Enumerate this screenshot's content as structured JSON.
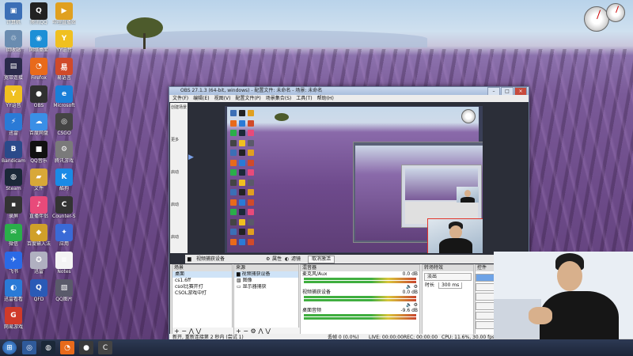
{
  "colors": {
    "taskbar": "#1c2538",
    "obs_bg": "#2b2e38",
    "selection_border": "#e3362b",
    "lavender": "#6c4a88"
  },
  "desktop_icons": [
    {
      "label": "计算机",
      "icon": "computer-icon",
      "color": "#3b6fb6",
      "glyph": "▣"
    },
    {
      "label": "腾讯QQ",
      "icon": "qq-penguin-icon",
      "color": "#222222",
      "glyph": "Q"
    },
    {
      "label": "哔哩直播姬",
      "icon": "live-app-icon",
      "color": "#e0a020",
      "glyph": "▶"
    },
    {
      "label": "回收站",
      "icon": "recycle-bin-icon",
      "color": "#6a8cb0",
      "glyph": "♲"
    },
    {
      "label": "网络桌面",
      "icon": "network-icon",
      "color": "#1d8fd6",
      "glyph": "◉"
    },
    {
      "label": "YY语音",
      "icon": "yy-icon",
      "color": "#f0c020",
      "glyph": "Y"
    },
    {
      "label": "宽带连接",
      "icon": "file-icon",
      "color": "#2a2a4a",
      "glyph": "▤"
    },
    {
      "label": "Firefox",
      "icon": "firefox-icon",
      "color": "#e86a1b",
      "glyph": "◔"
    },
    {
      "label": "易语言",
      "icon": "app-icon",
      "color": "#d04a2a",
      "glyph": "易"
    },
    {
      "label": "YY语音",
      "icon": "yy-icon",
      "color": "#f0c020",
      "glyph": "Y"
    },
    {
      "label": "OBS",
      "icon": "obs-icon",
      "color": "#303030",
      "glyph": "●"
    },
    {
      "label": "Microsoft",
      "icon": "edge-icon",
      "color": "#1a7fd8",
      "glyph": "e"
    },
    {
      "label": "迅雷",
      "icon": "thunder-icon",
      "color": "#2a7ad6",
      "glyph": "⚡"
    },
    {
      "label": "百度网盘",
      "icon": "netdisk-icon",
      "color": "#3a8fe6",
      "glyph": "☁"
    },
    {
      "label": "CSGO",
      "icon": "game-icon",
      "color": "#444444",
      "glyph": "◎"
    },
    {
      "label": "Bandicam",
      "icon": "bandicam-icon",
      "color": "#2a4a8a",
      "glyph": "B"
    },
    {
      "label": "QQ音乐",
      "icon": "black-app-icon",
      "color": "#111111",
      "glyph": "■"
    },
    {
      "label": "腾讯游戏",
      "icon": "gear-app-icon",
      "color": "#7a7a7a",
      "glyph": "⚙"
    },
    {
      "label": "Steam",
      "icon": "steam-icon",
      "color": "#1b2838",
      "glyph": "◍"
    },
    {
      "label": "文件",
      "icon": "folder-icon",
      "color": "#d8a838",
      "glyph": "▰"
    },
    {
      "label": "酷狗",
      "icon": "kugou-icon",
      "color": "#1a8ae6",
      "glyph": "K"
    },
    {
      "label": "录屏",
      "icon": "camera-app-icon",
      "color": "#333333",
      "glyph": "▪"
    },
    {
      "label": "直播伴侣",
      "icon": "live-app-icon",
      "color": "#e84a7a",
      "glyph": "♪"
    },
    {
      "label": "Counter-Strike",
      "icon": "cs-icon",
      "color": "#333333",
      "glyph": "C"
    },
    {
      "label": "微信",
      "icon": "wechat-icon",
      "color": "#2aae4a",
      "glyph": "✉"
    },
    {
      "label": "百度输入法",
      "icon": "app-icon",
      "color": "#d0a02a",
      "glyph": "◆"
    },
    {
      "label": "应用",
      "icon": "app-icon",
      "color": "#3a6ad6",
      "glyph": "✦"
    },
    {
      "label": "飞书",
      "icon": "feishu-icon",
      "color": "#2a6ae6",
      "glyph": "✈"
    },
    {
      "label": "迅雷",
      "icon": "tray-app-icon",
      "color": "#b0b0c0",
      "glyph": "✪"
    },
    {
      "label": "Notes",
      "icon": "document-icon",
      "color": "#f4f4f4",
      "glyph": "≡"
    },
    {
      "label": "迅雷看看",
      "icon": "blue-bird-icon",
      "color": "#2a7ad6",
      "glyph": "◐"
    },
    {
      "label": "QFD",
      "icon": "qfd-icon",
      "color": "#2a5ab6",
      "glyph": "Q"
    },
    {
      "label": "QQ图片",
      "icon": "image-icon",
      "color": "#5a5a6a",
      "glyph": "▧"
    },
    {
      "label": "网易游戏",
      "icon": "game-platform-icon",
      "color": "#d03a2a",
      "glyph": "G"
    }
  ],
  "obs": {
    "title": "OBS 27.1.3 (64-bit, windows) - 配置文件: 未命名 - 场景: 未命名",
    "menu": [
      "文件(F)",
      "编辑(E)",
      "视图(V)",
      "配置文件(P)",
      "场景集合(S)",
      "工具(T)",
      "帮助(H)"
    ],
    "toolbar": {
      "source": "视频捕获设备",
      "properties": "属性",
      "filters": "滤镜",
      "device": "取消激活"
    },
    "docks": {
      "scenes": {
        "title": "场景",
        "items": [
          "桌面",
          "cs1.6ff",
          "csol比赛开打",
          "CSOL游戏中打"
        ]
      },
      "sources": {
        "title": "来源",
        "items": [
          "视频捕获设备",
          "图像",
          "显示器捕获"
        ]
      },
      "mixer": {
        "title": "混音器",
        "rows": [
          {
            "name": "麦克风/Aux",
            "db": "0.0 dB"
          },
          {
            "name": "视频捕获设备",
            "db": "0.0 dB"
          },
          {
            "name": "桌面音频",
            "db": "-9.6 dB"
          }
        ]
      },
      "transitions": {
        "title": "转场特效",
        "type": "淡出",
        "duration_label": "时长",
        "duration": "300 ms"
      },
      "controls": {
        "title": "控件"
      }
    },
    "status": {
      "left": "新开, 重新连接第 2 秒内 (尝试 1)",
      "dropped": "丢帧 0 (0.0%)",
      "live": "LIVE: 00:00:00",
      "rec": "REC: 00:00:00",
      "cpu": "CPU: 11.6%, 30.00 fps"
    },
    "left_labels": [
      "创建场景",
      "更多",
      "启动",
      "启动",
      "启动"
    ]
  }
}
